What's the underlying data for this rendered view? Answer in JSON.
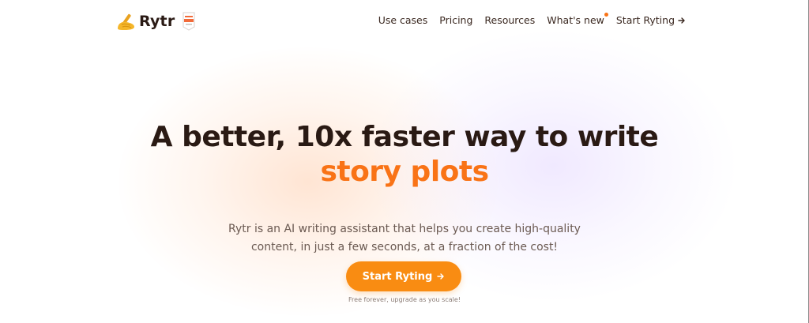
{
  "brand": {
    "name": "Rytr",
    "logo_icon": "writing-hand-icon",
    "badge_icon": "award-badge-icon"
  },
  "nav": {
    "items": [
      {
        "label": "Use cases"
      },
      {
        "label": "Pricing"
      },
      {
        "label": "Resources"
      },
      {
        "label": "What's new",
        "has_dot": true
      }
    ],
    "cta_label": "Start Ryting",
    "cta_icon": "arrow-right-icon"
  },
  "hero": {
    "headline": "A better, 10x faster way to write",
    "headline_accent": "story plots",
    "subtext": "Rytr is an AI writing assistant that helps you create high-quality content, in just a few seconds, at a fraction of the cost!",
    "cta_label": "Start Ryting",
    "cta_icon": "arrow-right-icon",
    "cta_note": "Free forever, upgrade as you scale!"
  },
  "colors": {
    "accent": "#f97316",
    "button": "#f98c12",
    "text": "#2a1a14",
    "muted": "#6b5a52"
  }
}
